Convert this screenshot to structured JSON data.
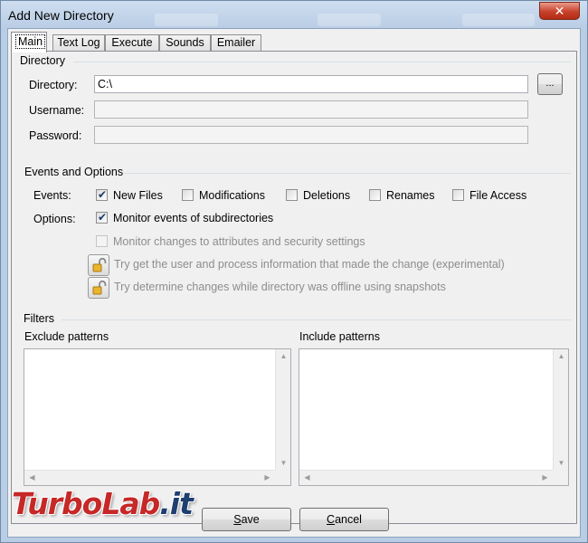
{
  "window": {
    "title": "Add New Directory",
    "close_glyph": "✕"
  },
  "tabs": [
    {
      "label": "Main",
      "active": true
    },
    {
      "label": "Text Log",
      "active": false
    },
    {
      "label": "Execute",
      "active": false
    },
    {
      "label": "Sounds",
      "active": false
    },
    {
      "label": "Emailer",
      "active": false
    }
  ],
  "directory_group": {
    "title": "Directory",
    "directory_label": "Directory:",
    "directory_value": "C:\\",
    "browse_label": "...",
    "username_label": "Username:",
    "username_value": "",
    "password_label": "Password:",
    "password_value": ""
  },
  "events_group": {
    "title": "Events and Options",
    "events_label": "Events:",
    "options_label": "Options:",
    "events": [
      {
        "label": "New Files",
        "checked": true
      },
      {
        "label": "Modifications",
        "checked": false
      },
      {
        "label": "Deletions",
        "checked": false
      },
      {
        "label": "Renames",
        "checked": false
      },
      {
        "label": "File Access",
        "checked": false
      }
    ],
    "monitor_subdirs": {
      "label": "Monitor events of subdirectories",
      "checked": true
    },
    "monitor_attributes": {
      "label": "Monitor changes to attributes and security settings",
      "checked": false,
      "disabled": true
    },
    "try_user_info": "Try get the user and process information that made the change (experimental)",
    "try_offline": "Try determine changes while directory was offline using snapshots"
  },
  "filters_group": {
    "title": "Filters",
    "exclude_label": "Exclude patterns",
    "include_label": "Include patterns"
  },
  "footer": {
    "save_label": "Save",
    "save_mnemonic": "S",
    "cancel_label": "Cancel",
    "cancel_mnemonic": "C"
  },
  "watermark": {
    "part1": "TurboLab",
    "part2": ".it"
  },
  "colors": {
    "accent_red": "#c62828",
    "accent_blue": "#1e3f70",
    "close_button": "#c7412a"
  }
}
